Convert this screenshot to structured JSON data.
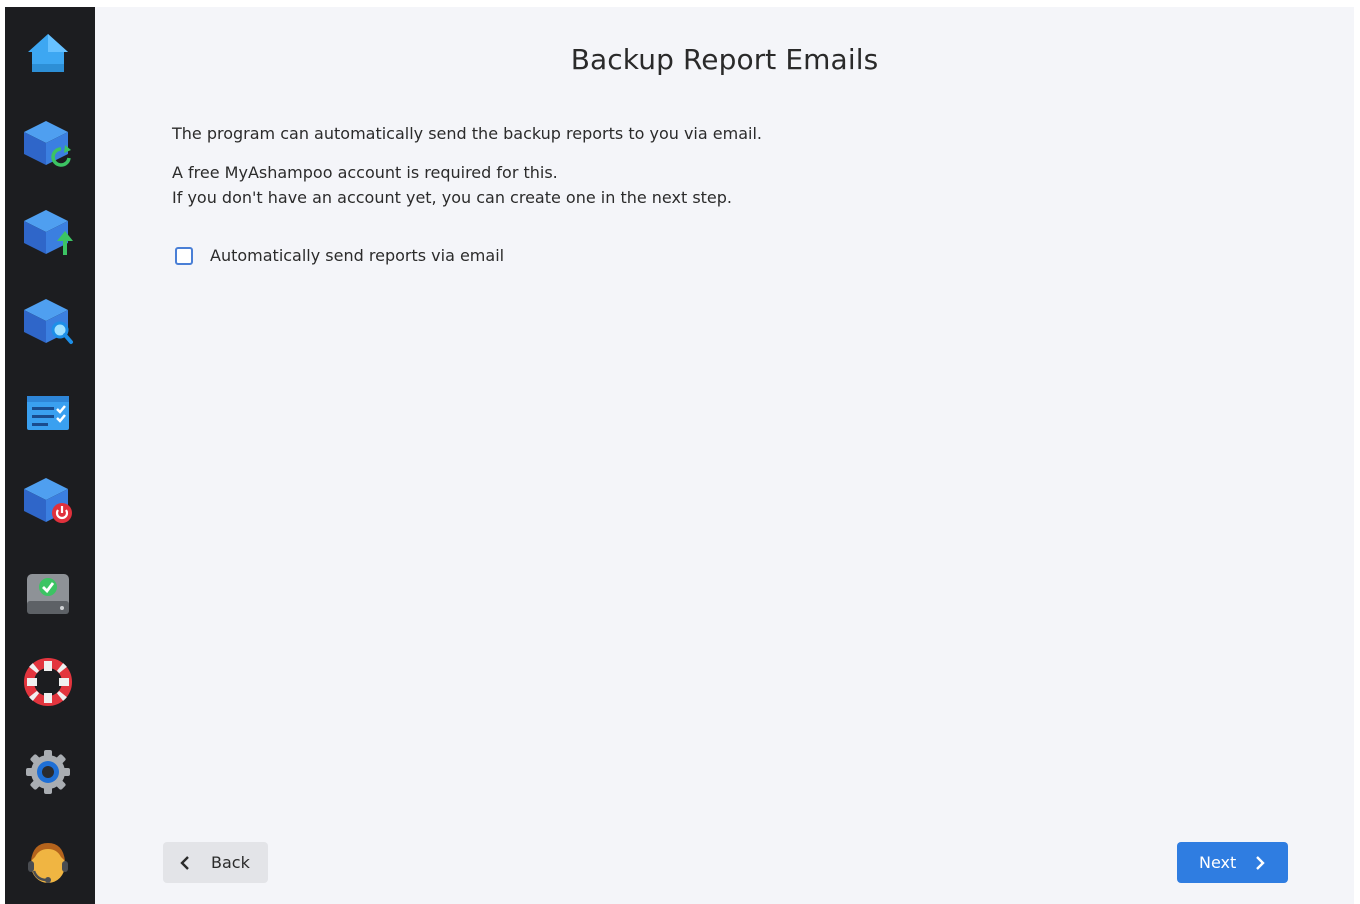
{
  "sidebar": {
    "items": [
      {
        "icon": "home-icon"
      },
      {
        "icon": "backup-restore-icon"
      },
      {
        "icon": "backup-upload-icon"
      },
      {
        "icon": "backup-search-icon"
      },
      {
        "icon": "checklist-icon"
      },
      {
        "icon": "backup-shutdown-icon"
      },
      {
        "icon": "drive-check-icon"
      },
      {
        "icon": "help-lifebuoy-icon"
      },
      {
        "icon": "settings-gear-icon"
      },
      {
        "icon": "support-agent-icon"
      }
    ]
  },
  "main": {
    "title": "Backup Report Emails",
    "intro": "The program can automatically send the backup reports to you via email.",
    "account_line1": "A free MyAshampoo account is required for this.",
    "account_line2": "If you don't have an account yet, you can create one in the next step.",
    "checkbox": {
      "label": "Automatically send reports via email",
      "checked": false
    }
  },
  "footer": {
    "back_label": "Back",
    "next_label": "Next"
  },
  "colors": {
    "sidebar_bg": "#1c1d20",
    "content_bg": "#f4f5f9",
    "accent": "#2f7de1",
    "checkbox_border": "#4a7fd6"
  }
}
